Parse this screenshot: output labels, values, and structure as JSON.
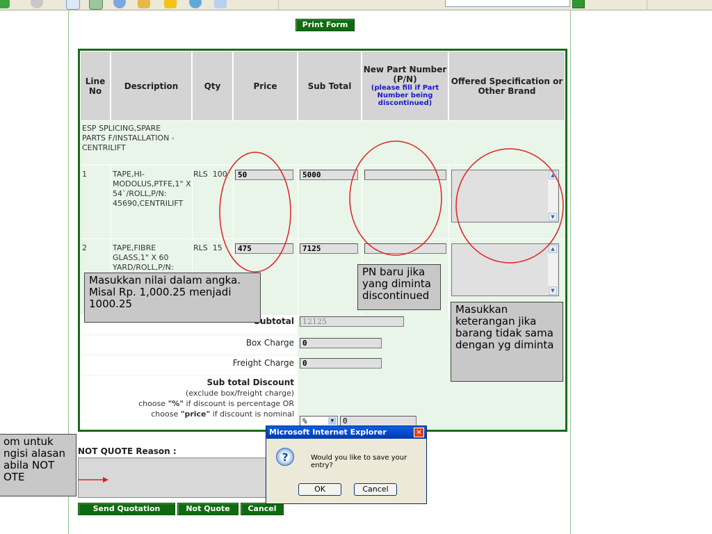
{
  "toolbar": {
    "icons": [
      "back-icon",
      "forward-icon",
      "document-icon",
      "picture-icon",
      "globe-icon",
      "pencil-icon",
      "star-icon",
      "refresh-icon",
      "folder-icon"
    ],
    "go_icon": "go-arrow-icon"
  },
  "print_button": "Print Form",
  "table": {
    "headers": {
      "line_no": "Line No",
      "description": "Description",
      "qty": "Qty",
      "price": "Price",
      "sub_total": "Sub Total",
      "new_pn": "New Part Number (P/N)",
      "new_pn_note": "(please fill if Part Number being discontinued)",
      "offered": "Offered Specification or Other Brand"
    },
    "group_label": "ESP SPLICING,SPARE PARTS F/INSTALLATION -CENTRILIFT",
    "rows": [
      {
        "line": "1",
        "description": "TAPE,HI-MODOLUS,PTFE,1\" X 54`/ROLL,P/N: 45690,CENTRILIFT",
        "qty": "RLS  100",
        "price": "50",
        "sub_total": "5000",
        "new_pn": ""
      },
      {
        "line": "2",
        "description": "TAPE,FIBRE GLASS,1\" X 60 YARD/ROLL,P/N:",
        "qty": "RLS  15",
        "price": "475",
        "sub_total": "7125",
        "new_pn": ""
      }
    ],
    "subtotal_label": "Subtotal",
    "subtotal_value": "12125",
    "box_charge_label": "Box Charge",
    "box_charge_value": "0",
    "freight_charge_label": "Freight Charge",
    "freight_charge_value": "0",
    "discount": {
      "title": "Sub total Discount",
      "line1": "(exclude box/freight charge)",
      "line2_prefix": "choose ",
      "line2_bold": "\"%\"",
      "line2_suffix": " if discount is percentage OR",
      "line3_prefix": "choose ",
      "line3_bold": "\"price\"",
      "line3_suffix": " if discount is nominal",
      "type_value": "%",
      "value": "0"
    }
  },
  "not_quote": {
    "label": "NOT QUOTE Reason :"
  },
  "buttons": {
    "send": "Send Quotation",
    "not_quote": "Not Quote",
    "cancel": "Cancel"
  },
  "callouts": {
    "price_hint": "Masukkan nilai dalam angka. Misal Rp. 1,000.25 menjadi 1000.25",
    "pn_hint": "PN baru jika yang diminta discontinued",
    "spec_hint": "Masukkan keterangan jika barang tidak sama dengan yg diminta",
    "notquote_hint": "om untuk ngisi alasan abila NOT OTE"
  },
  "dialog": {
    "title": "Microsoft Internet Explorer",
    "message": "Would you like to save your entry?",
    "ok": "OK",
    "cancel": "Cancel",
    "icon": "question-icon"
  },
  "colors": {
    "accent_green": "#0f6b0f",
    "annotation_red": "#e02020",
    "callout_gray": "#c8c8c8"
  }
}
